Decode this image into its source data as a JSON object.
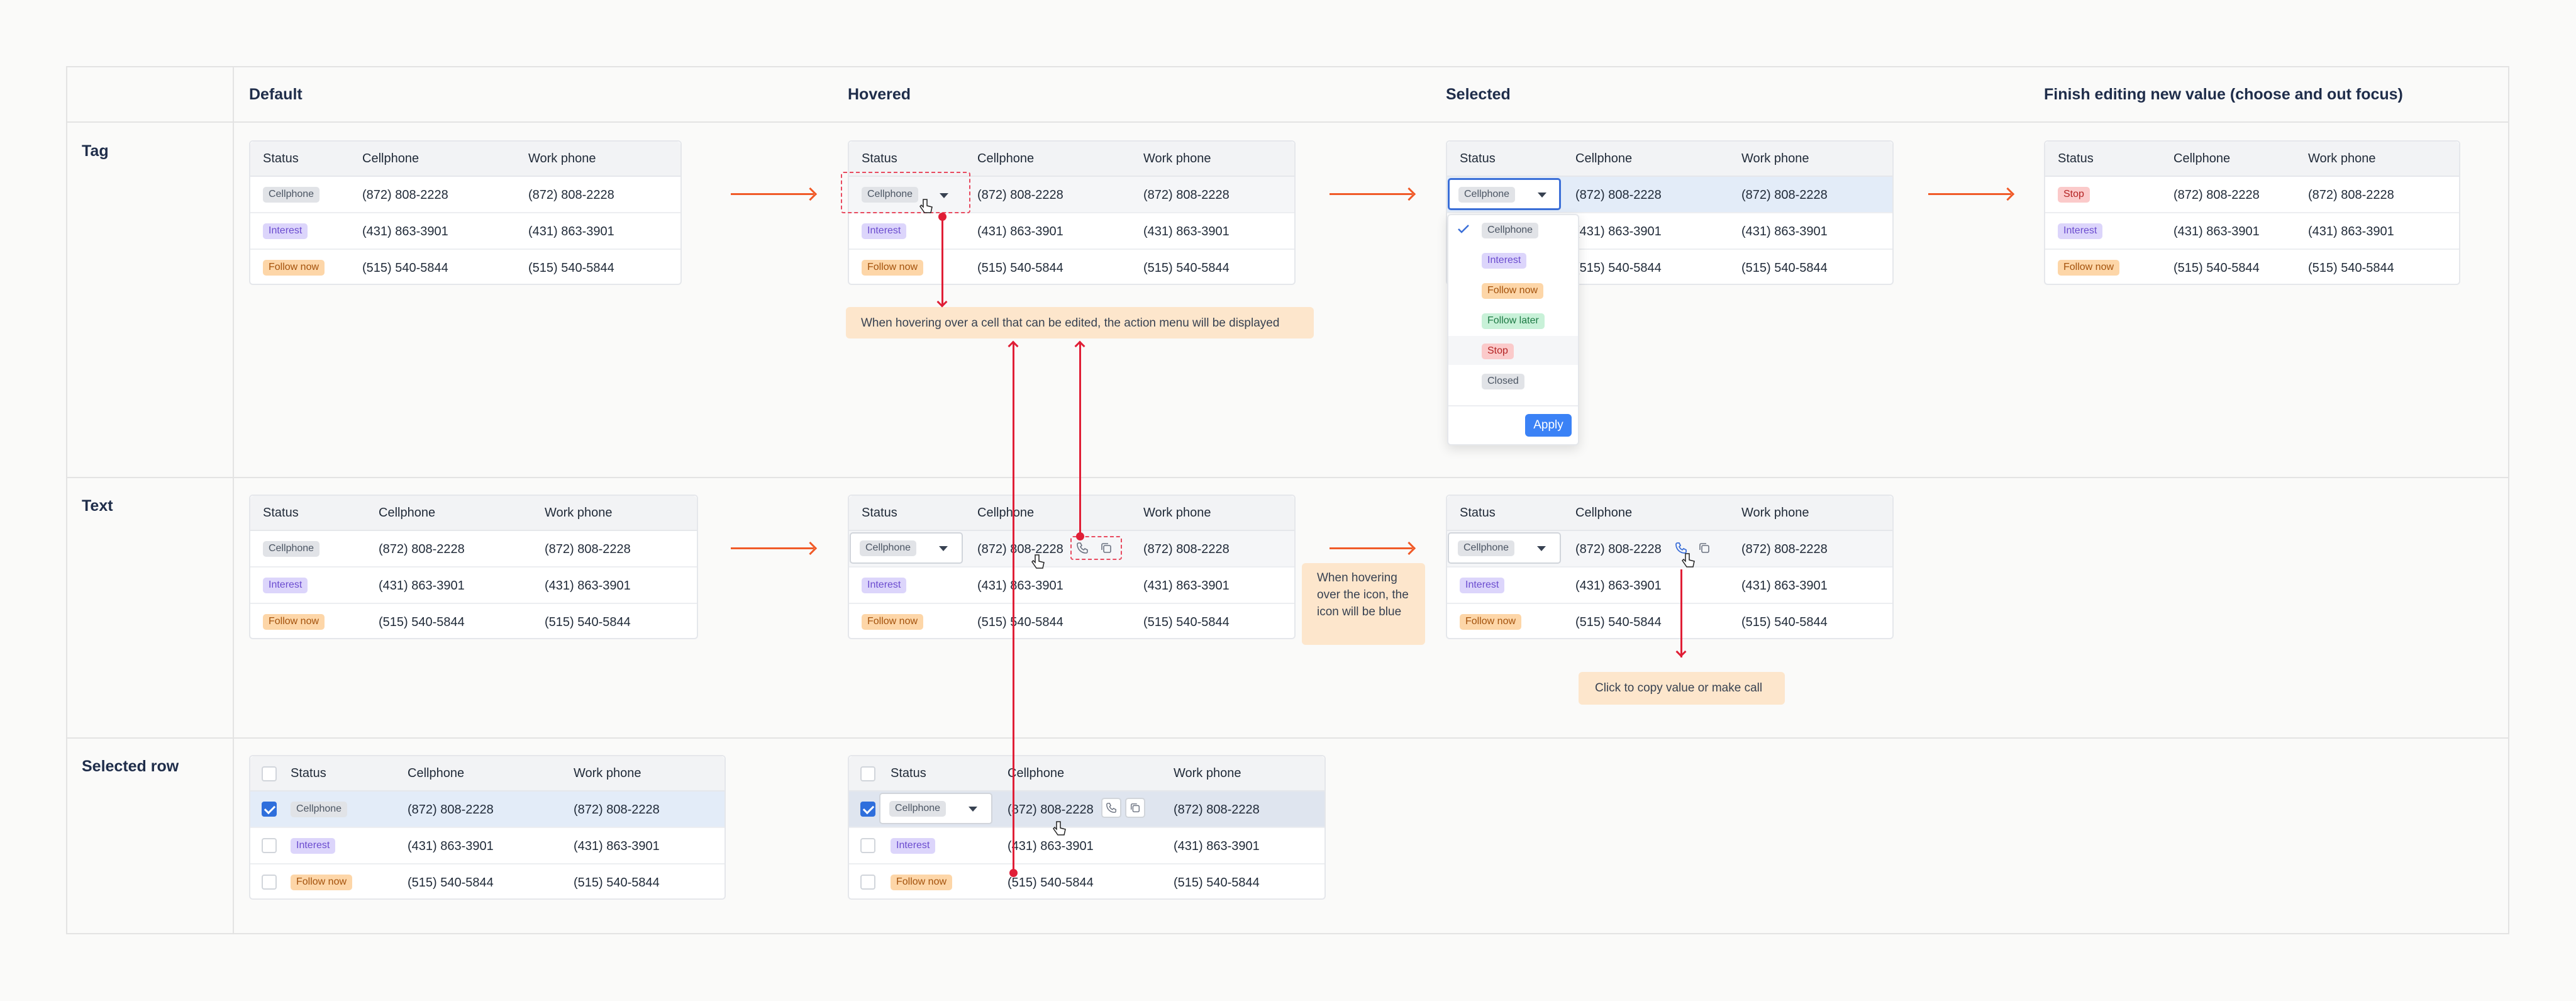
{
  "columns": {
    "default": "Default",
    "hovered": "Hovered",
    "selected": "Selected",
    "finish": "Finish editing new value (choose and out focus)"
  },
  "rows": {
    "tag": "Tag",
    "text": "Text",
    "selected_row": "Selected row"
  },
  "table": {
    "headers": [
      "Status",
      "Cellphone",
      "Work phone"
    ],
    "data": [
      {
        "status": "Cellphone",
        "cell": "(872) 808-2228",
        "work": "(872) 808-2228"
      },
      {
        "status": "Interest",
        "cell": "(431) 863-3901",
        "work": "(431) 863-3901"
      },
      {
        "status": "Follow now",
        "cell": "(515) 540-5844",
        "work": "(515) 540-5844"
      }
    ],
    "finish_status": "Stop"
  },
  "dropdown": {
    "options": [
      "Cellphone",
      "Interest",
      "Follow now",
      "Follow later",
      "Stop",
      "Closed"
    ],
    "selected": "Cellphone",
    "apply": "Apply"
  },
  "notes": {
    "hover_menu": "When hovering over a cell that can be edited, the action menu will be displayed",
    "hover_icon": "When hovering over the icon, the icon will be blue",
    "copy": "Click to copy value or make call"
  },
  "icons": [
    "check-icon",
    "caret-down-icon",
    "phone-icon",
    "copy-icon",
    "hand-cursor-icon",
    "arrow-right-icon"
  ],
  "colors": {
    "accent": "#3b82f6",
    "arrow": "#f05a28",
    "annotation": "#e01e36",
    "note_bg": "#fde6cc"
  }
}
